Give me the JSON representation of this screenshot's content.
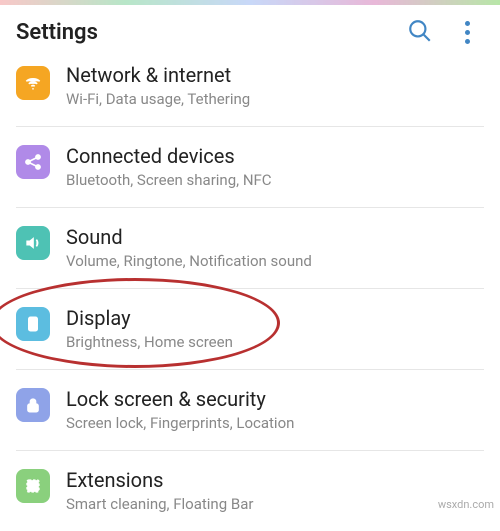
{
  "header": {
    "title": "Settings"
  },
  "items": [
    {
      "title": "Network & internet",
      "subtitle": "Wi-Fi, Data usage, Tethering",
      "color": "#f5a623"
    },
    {
      "title": "Connected devices",
      "subtitle": "Bluetooth, Screen sharing, NFC",
      "color": "#b08ae8"
    },
    {
      "title": "Sound",
      "subtitle": "Volume, Ringtone, Notification sound",
      "color": "#4ec2b4"
    },
    {
      "title": "Display",
      "subtitle": "Brightness, Home screen",
      "color": "#5cbde0"
    },
    {
      "title": "Lock screen & security",
      "subtitle": "Screen lock, Fingerprints, Location",
      "color": "#8fa3e8"
    },
    {
      "title": "Extensions",
      "subtitle": "Smart cleaning, Floating Bar",
      "color": "#8ad07d"
    }
  ],
  "watermark": "wsxdn.com"
}
